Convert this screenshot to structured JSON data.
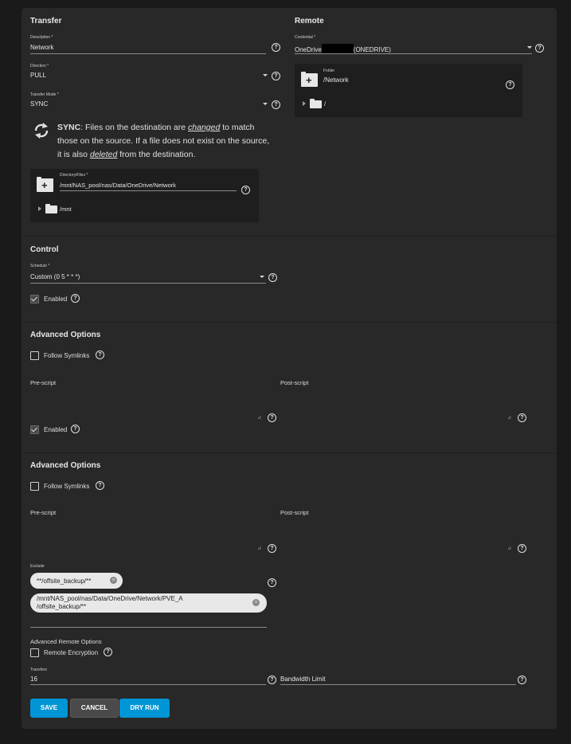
{
  "transfer": {
    "title": "Transfer",
    "description": {
      "label": "Description *",
      "value": "Network"
    },
    "direction": {
      "label": "Direction *",
      "value": "PULL"
    },
    "transfer_mode": {
      "label": "Transfer Mode *",
      "value": "SYNC"
    },
    "sync_info": {
      "keyword": "SYNC",
      "text1": ": Files on the destination are ",
      "em1": "changed",
      "text2": " to match",
      "line2": "those on the source. If a file does not exist on the source,",
      "text3": "it is also ",
      "em2": "deleted",
      "text4": " from the destination."
    },
    "directory": {
      "label": "Directory/Files *",
      "value": "/mnt/NAS_pool/nas/Data/OneDrive/Network",
      "tree_item": "/mnt"
    }
  },
  "remote": {
    "title": "Remote",
    "credential": {
      "label": "Credential *",
      "value_prefix": "OneDrive",
      "value_suffix": "(ONEDRIVE)"
    },
    "folder": {
      "label": "Folder",
      "value": "/Network",
      "tree_item": "/"
    }
  },
  "control": {
    "title": "Control",
    "schedule": {
      "label": "Schedule *",
      "value": "Custom (0 5 * * *)"
    },
    "enabled_label": "Enabled"
  },
  "advanced1": {
    "title": "Advanced Options",
    "follow_symlinks": "Follow Symlinks",
    "pre_script": "Pre-script",
    "post_script": "Post-script",
    "enabled_label": "Enabled"
  },
  "advanced2": {
    "title": "Advanced Options",
    "follow_symlinks": "Follow Symlinks",
    "pre_script": "Pre-script",
    "post_script": "Post-script",
    "exclude": {
      "label": "Exclude",
      "chip1": "**/offsite_backup/**",
      "chip2_line1": "/mnt/NAS_pool/nas/Data/OneDrive/Network/PVE_A",
      "chip2_line2": "/offsite_backup/**"
    },
    "advanced_remote_title": "Advanced Remote Options",
    "remote_encryption": "Remote Encryption",
    "transfers": {
      "label": "Transfers",
      "value": "16"
    },
    "bandwidth_limit": "Bandwidth Limit"
  },
  "buttons": {
    "save": "SAVE",
    "cancel": "CANCEL",
    "dry_run": "DRY RUN"
  },
  "colors": {
    "primary": "#0095d5",
    "cancel": "#4a4a4a",
    "panel": "#282828",
    "background": "#1a1a1a"
  }
}
